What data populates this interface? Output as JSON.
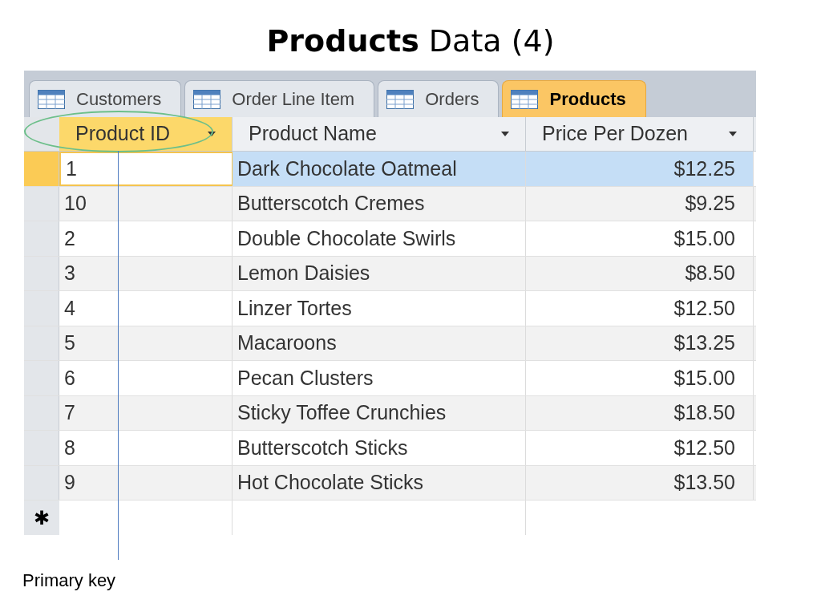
{
  "slide_title": "**Products** Data (4)",
  "tabs": [
    {
      "label": "Customers",
      "selected": false
    },
    {
      "label": "Order Line Item",
      "selected": false
    },
    {
      "label": "Orders",
      "selected": false
    },
    {
      "label": "Products",
      "selected": true
    }
  ],
  "columns": [
    {
      "label": "Product ID",
      "selected": true
    },
    {
      "label": "Product Name",
      "selected": false
    },
    {
      "label": "Price Per Dozen",
      "selected": false
    }
  ],
  "rows": [
    {
      "cells": [
        "1",
        "Dark Chocolate Oatmeal",
        "$12.25"
      ],
      "selected": true
    },
    {
      "cells": [
        "10",
        "Butterscotch Cremes",
        "$9.25"
      ],
      "selected": false
    },
    {
      "cells": [
        "2",
        "Double Chocolate Swirls",
        "$15.00"
      ],
      "selected": false
    },
    {
      "cells": [
        "3",
        "Lemon Daisies",
        "$8.50"
      ],
      "selected": false
    },
    {
      "cells": [
        "4",
        "Linzer Tortes",
        "$12.50"
      ],
      "selected": false
    },
    {
      "cells": [
        "5",
        "Macaroons",
        "$13.25"
      ],
      "selected": false
    },
    {
      "cells": [
        "6",
        "Pecan Clusters",
        "$15.00"
      ],
      "selected": false
    },
    {
      "cells": [
        "7",
        "Sticky Toffee Crunchies",
        "$18.50"
      ],
      "selected": false
    },
    {
      "cells": [
        "8",
        "Butterscotch Sticks",
        "$12.50"
      ],
      "selected": false
    },
    {
      "cells": [
        "9",
        "Hot Chocolate Sticks",
        "$13.50"
      ],
      "selected": false
    }
  ],
  "new_row_marker": "✱",
  "annotation": "Primary key"
}
